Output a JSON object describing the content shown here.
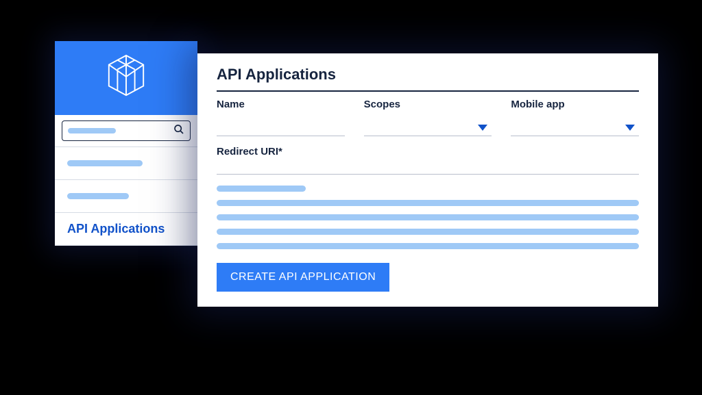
{
  "sidebar": {
    "active_item_label": "API Applications"
  },
  "main": {
    "title": "API Applications",
    "fields": {
      "name_label": "Name",
      "scopes_label": "Scopes",
      "mobile_app_label": "Mobile app",
      "redirect_label": "Redirect URI*"
    },
    "submit_label": "CREATE API APPLICATION"
  }
}
